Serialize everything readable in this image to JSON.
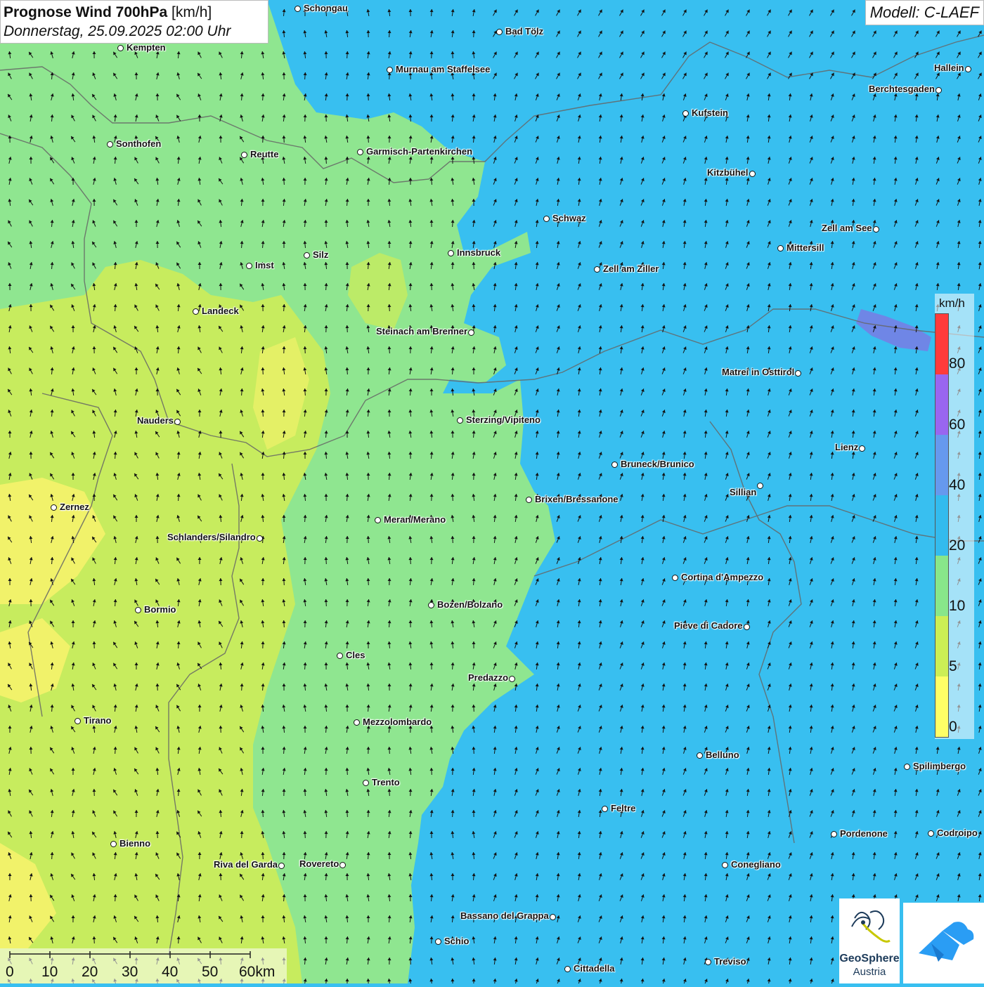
{
  "header": {
    "title_bold": "Prognose Wind 700hPa",
    "title_unit": "[km/h]",
    "datetime": "Donnerstag, 25.09.2025 02:00 Uhr",
    "model": "Modell: C-LAEF"
  },
  "legend": {
    "unit": "km/h",
    "labels": [
      "80",
      "60",
      "40",
      "20",
      "10",
      "5",
      "0"
    ],
    "colors": [
      "#ff3b3b",
      "#9966f0",
      "#6699ee",
      "#33bbee",
      "#88e68a",
      "#ccee55",
      "#ffff66"
    ]
  },
  "scalebar": {
    "labels": [
      "0",
      "10",
      "20",
      "30",
      "40",
      "50",
      "60km"
    ]
  },
  "logos": {
    "geosphere_line1": "GeoSphere",
    "geosphere_line2": "Austria"
  },
  "cities": [
    {
      "name": "Schongau",
      "side": "right"
    },
    {
      "name": "Bad Tölz",
      "side": "right"
    },
    {
      "name": "Kempten",
      "side": "right"
    },
    {
      "name": "Murnau am Staffelsee",
      "side": "right"
    },
    {
      "name": "Hallein",
      "side": "left"
    },
    {
      "name": "Berchtesgaden",
      "side": "left"
    },
    {
      "name": "Kufstein",
      "side": "right"
    },
    {
      "name": "Sonthofen",
      "side": "right"
    },
    {
      "name": "Reutte",
      "side": "right"
    },
    {
      "name": "Garmisch-Partenkirchen",
      "side": "right"
    },
    {
      "name": "Kitzbühel",
      "side": "left"
    },
    {
      "name": "Schwaz",
      "side": "right"
    },
    {
      "name": "Zell am See",
      "side": "left"
    },
    {
      "name": "Innsbruck",
      "side": "right"
    },
    {
      "name": "Mittersill",
      "side": "right"
    },
    {
      "name": "Silz",
      "side": "right"
    },
    {
      "name": "Imst",
      "side": "right"
    },
    {
      "name": "Zell am Ziller",
      "side": "right"
    },
    {
      "name": "Landeck",
      "side": "right"
    },
    {
      "name": "Steinach am Brenner",
      "side": "left"
    },
    {
      "name": "Matrei in Osttirol",
      "side": "left"
    },
    {
      "name": "Nauders",
      "side": "left"
    },
    {
      "name": "Sterzing/Vipiteno",
      "side": "right"
    },
    {
      "name": "Lienz",
      "side": "left"
    },
    {
      "name": "Bruneck/Brunico",
      "side": "right"
    },
    {
      "name": "Sillian",
      "side": "below-left"
    },
    {
      "name": "Brixen/Bressanone",
      "side": "right"
    },
    {
      "name": "Zernez",
      "side": "right"
    },
    {
      "name": "Meran/Merano",
      "side": "right"
    },
    {
      "name": "Schlanders/Silandro",
      "side": "left"
    },
    {
      "name": "Cortina d'Ampezzo",
      "side": "right"
    },
    {
      "name": "Bozen/Bolzano",
      "side": "right"
    },
    {
      "name": "Bormio",
      "side": "right"
    },
    {
      "name": "Pieve di Cadore",
      "side": "left"
    },
    {
      "name": "Cles",
      "side": "right"
    },
    {
      "name": "Predazzo",
      "side": "left"
    },
    {
      "name": "Tirano",
      "side": "right"
    },
    {
      "name": "Mezzolombardo",
      "side": "right"
    },
    {
      "name": "Belluno",
      "side": "right"
    },
    {
      "name": "Spilimbergo",
      "side": "right"
    },
    {
      "name": "Trento",
      "side": "right"
    },
    {
      "name": "Feltre",
      "side": "right"
    },
    {
      "name": "Pordenone",
      "side": "right"
    },
    {
      "name": "Codroipo",
      "side": "right"
    },
    {
      "name": "Bienno",
      "side": "right"
    },
    {
      "name": "Riva del Garda",
      "side": "left"
    },
    {
      "name": "Rovereto",
      "side": "left"
    },
    {
      "name": "Conegliano",
      "side": "right"
    },
    {
      "name": "Bassano del Grappa",
      "side": "left"
    },
    {
      "name": "Schio",
      "side": "right"
    },
    {
      "name": "Treviso",
      "side": "right"
    },
    {
      "name": "Cittadella",
      "side": "right"
    }
  ]
}
